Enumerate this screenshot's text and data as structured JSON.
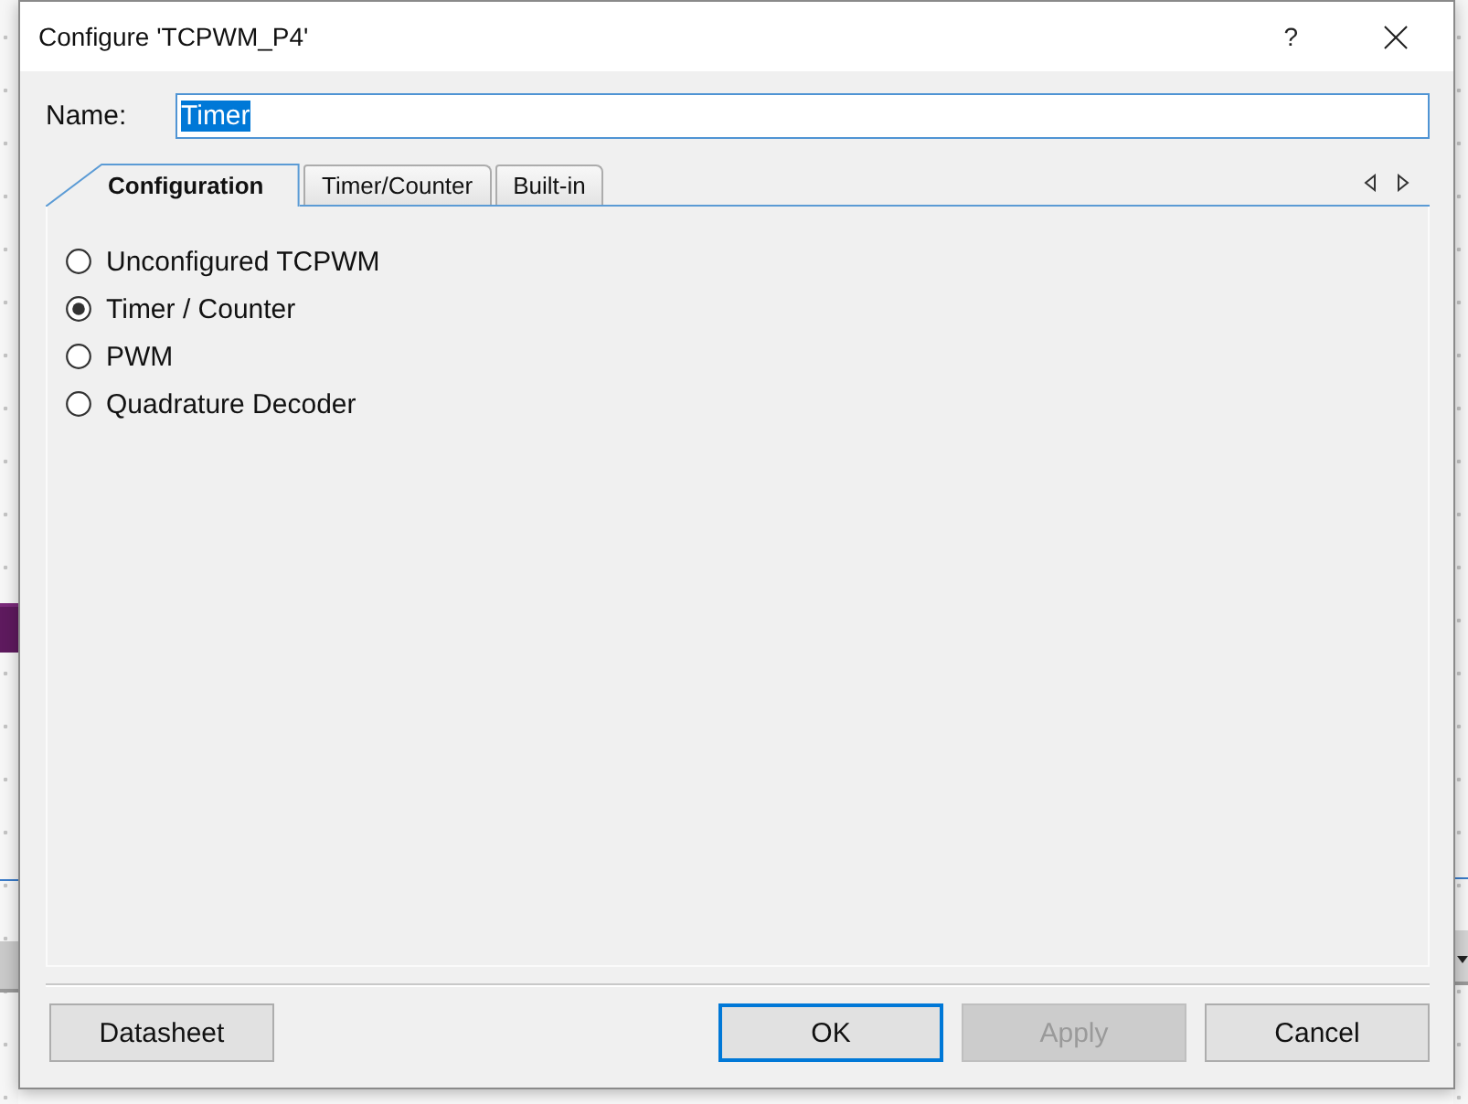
{
  "window": {
    "title": "Configure 'TCPWM_P4'",
    "help": "?"
  },
  "name_field": {
    "label": "Name:",
    "value": "Timer",
    "text_selected": true
  },
  "tabs": [
    {
      "label": "Configuration",
      "selected": true
    },
    {
      "label": "Timer/Counter",
      "selected": false
    },
    {
      "label": "Built-in",
      "selected": false
    }
  ],
  "options": [
    {
      "label": "Unconfigured TCPWM",
      "selected": false
    },
    {
      "label": "Timer / Counter",
      "selected": true
    },
    {
      "label": "PWM",
      "selected": false
    },
    {
      "label": "Quadrature Decoder",
      "selected": false
    }
  ],
  "footer": {
    "left_buttons": [
      {
        "label": "Datasheet",
        "default": false,
        "disabled": false
      }
    ],
    "right_buttons": [
      {
        "label": "OK",
        "default": true,
        "disabled": false
      },
      {
        "label": "Apply",
        "default": false,
        "disabled": true
      },
      {
        "label": "Cancel",
        "default": false,
        "disabled": false
      }
    ]
  }
}
